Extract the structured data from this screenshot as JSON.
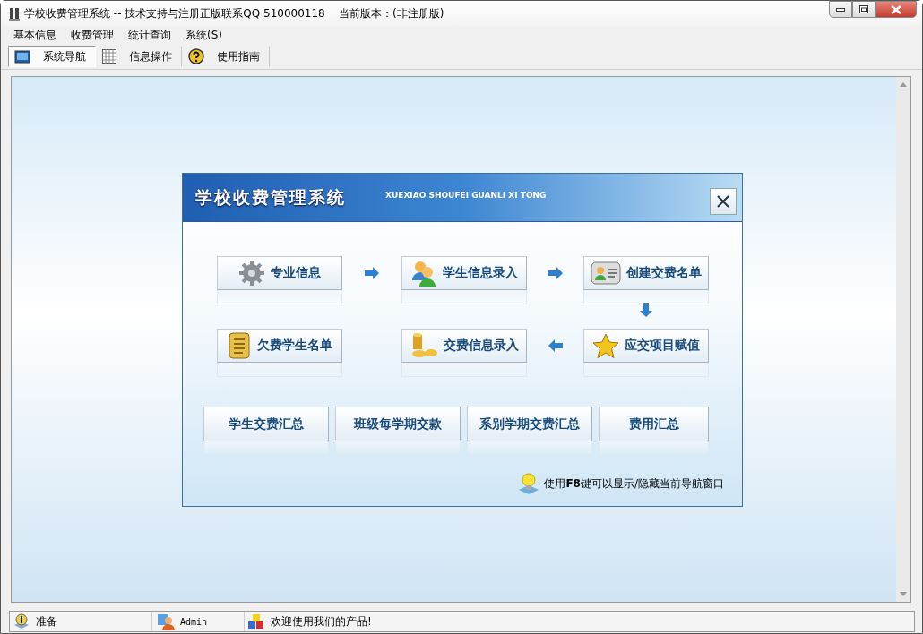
{
  "window": {
    "title": "学校收费管理系统 -- 技术支持与注册正版联系QQ 510000118    当前版本：(非注册版)"
  },
  "menu": [
    "基本信息",
    "收费管理",
    "统计查询",
    "系统(S)"
  ],
  "toolbar": [
    {
      "label": "系统导航",
      "kind": "monitor",
      "selected": true
    },
    {
      "label": "信息操作",
      "kind": "grid",
      "selected": false
    },
    {
      "label": "使用指南",
      "kind": "help",
      "selected": false
    }
  ],
  "nav_dialog": {
    "title": "学校收费管理系统",
    "subtitle": "XUEXIAO SHOUFEI GUANLI XI TONG",
    "flow": [
      {
        "label": "专业信息",
        "kind": "gear"
      },
      {
        "label": "学生信息录入",
        "kind": "people"
      },
      {
        "label": "创建交费名单",
        "kind": "card"
      },
      {
        "label": "欠费学生名单",
        "kind": "scroll"
      },
      {
        "label": "交费信息录入",
        "kind": "coins"
      },
      {
        "label": "应交项目赋值",
        "kind": "star"
      }
    ],
    "reports": [
      "学生交费汇总",
      "班级每学期交款",
      "系别学期交费汇总",
      "费用汇总"
    ],
    "hint": "使用**F8**键可以显示/隐藏当前导航窗口"
  },
  "status_bar": [
    {
      "text": "准备",
      "kind": "ready"
    },
    {
      "text": "Admin",
      "kind": "user"
    },
    {
      "text": "欢迎使用我们的产品!",
      "kind": "cubes"
    }
  ]
}
